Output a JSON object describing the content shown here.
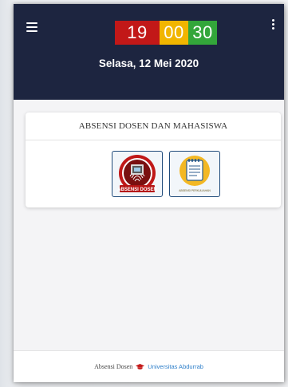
{
  "header": {
    "clock": {
      "hours": "19",
      "minutes": "00",
      "seconds": "30"
    },
    "date": "Selasa, 12 Mei 2020",
    "menu_icon": "hamburger-menu-icon",
    "more_icon": "more-vertical-icon"
  },
  "card": {
    "title": "ABSENSI DOSEN DAN MAHASISWA",
    "tiles": [
      {
        "label": "ABSENSI DOSEN",
        "icon": "fingerprint-logo"
      },
      {
        "label": "ABSENSI PERKULIAHAN",
        "icon": "notepad-icon"
      }
    ]
  },
  "footer": {
    "text": "Absensi Dosen",
    "link": "Universitas Abdurrab",
    "icon": "graduation-cap-icon"
  },
  "colors": {
    "header_bg": "#1d2540",
    "clock_hours": "#c21818",
    "clock_minutes": "#f1b500",
    "clock_seconds": "#33a63a",
    "link": "#2c7ec9"
  }
}
